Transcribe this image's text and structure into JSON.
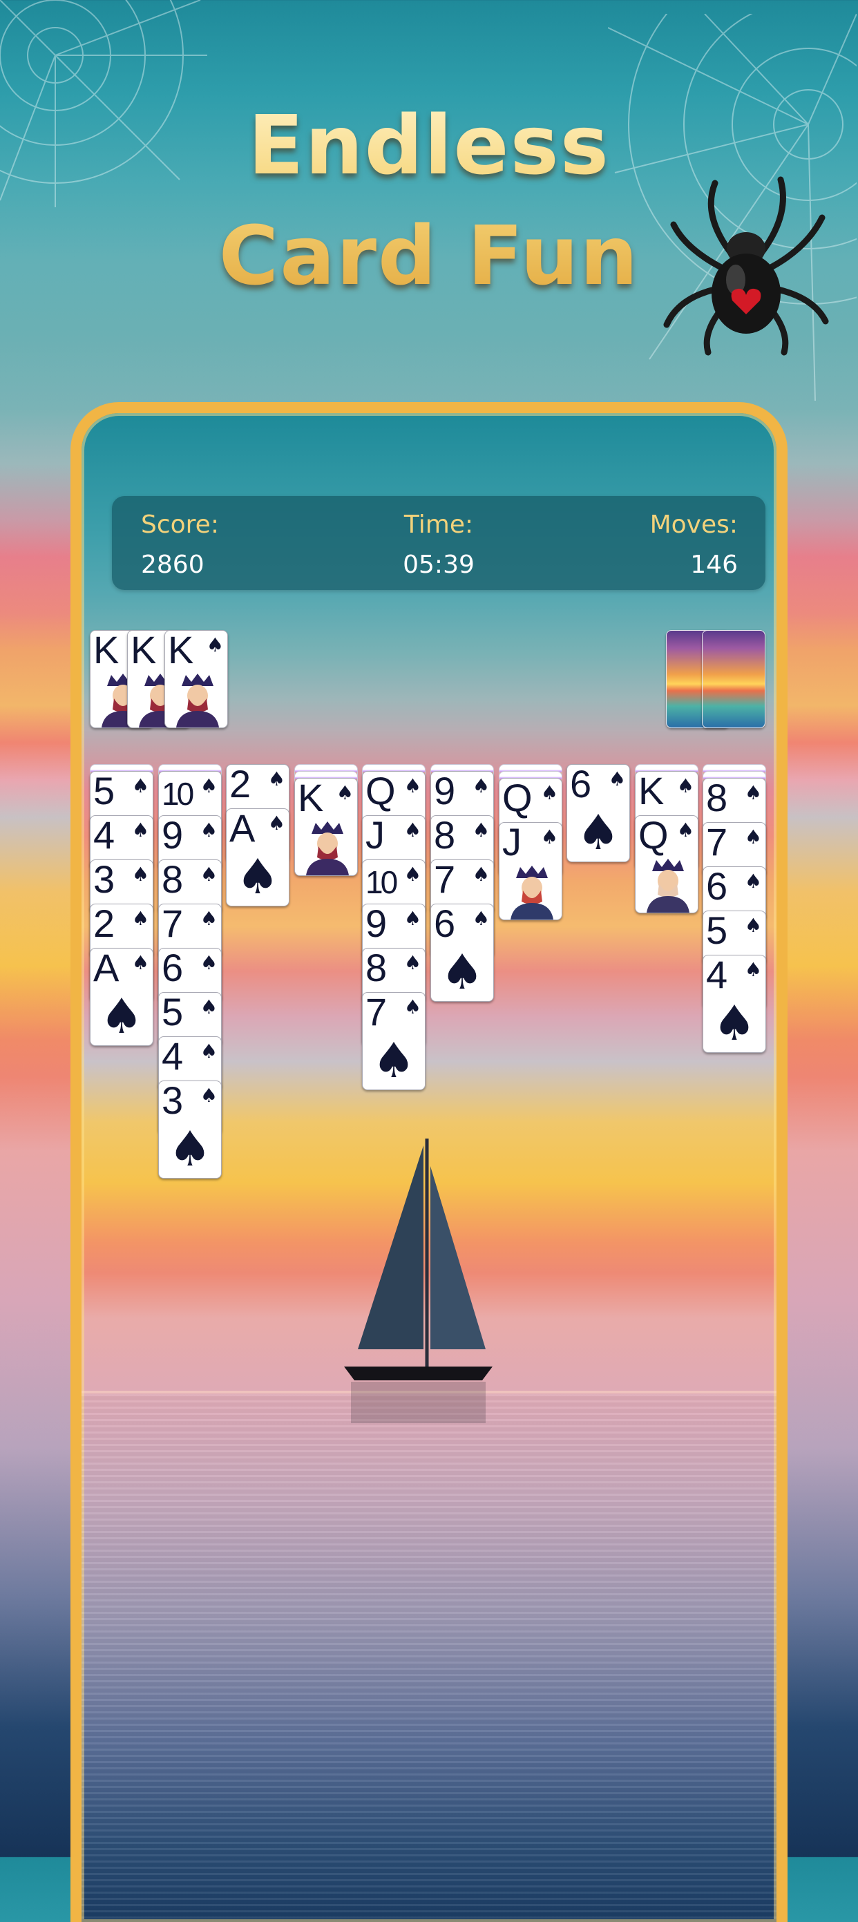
{
  "headline": {
    "line1": "Endless",
    "line2": "Card Fun"
  },
  "stats": {
    "score_label": "Score:",
    "score_value": "2860",
    "time_label": "Time:",
    "time_value": "05:39",
    "moves_label": "Moves:",
    "moves_value": "146"
  },
  "colors": {
    "frame": "#f1b545",
    "label": "#f2d27b",
    "card_ink": "#111633"
  },
  "completed_piles": [
    {
      "rank": "K",
      "suit": "♠"
    },
    {
      "rank": "K",
      "suit": "♠"
    },
    {
      "rank": "K",
      "suit": "♠"
    }
  ],
  "stock_piles": 2,
  "suit_symbol": "♠",
  "tableau": [
    {
      "hidden": 1,
      "cards": [
        "5",
        "4",
        "3",
        "2",
        "A"
      ]
    },
    {
      "hidden": 1,
      "cards": [
        "10",
        "9",
        "8",
        "7",
        "6",
        "5",
        "4",
        "3"
      ]
    },
    {
      "hidden": 0,
      "cards": [
        "2",
        "A"
      ]
    },
    {
      "hidden": 2,
      "cards": [
        "K"
      ]
    },
    {
      "hidden": 1,
      "cards": [
        "Q",
        "J",
        "10",
        "9",
        "8",
        "7"
      ]
    },
    {
      "hidden": 1,
      "cards": [
        "9",
        "8",
        "7",
        "6"
      ]
    },
    {
      "hidden": 2,
      "cards": [
        "Q",
        "J"
      ]
    },
    {
      "hidden": 0,
      "cards": [
        "6"
      ]
    },
    {
      "hidden": 1,
      "cards": [
        "K",
        "Q"
      ]
    },
    {
      "hidden": 2,
      "cards": [
        "8",
        "7",
        "6",
        "5",
        "4"
      ]
    }
  ],
  "icons": {
    "spider": "spider-icon",
    "web": "spider-web-icon",
    "boat": "sailboat-icon"
  }
}
